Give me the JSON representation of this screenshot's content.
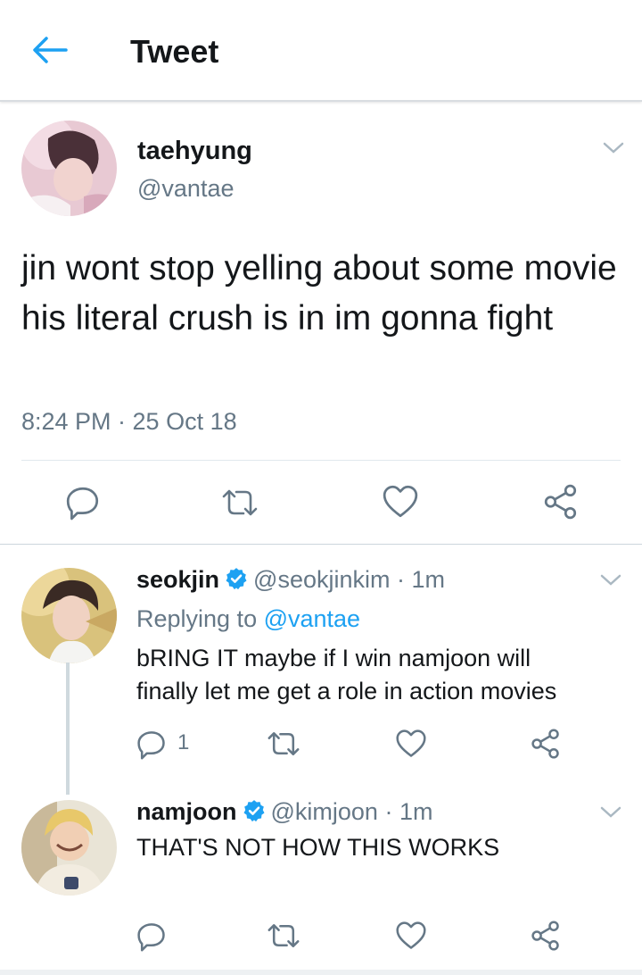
{
  "header": {
    "title": "Tweet"
  },
  "tweet": {
    "name": "taehyung",
    "handle": "@vantae",
    "text": "jin wont stop yelling about some movie his literal crush is in im gonna fight",
    "timestamp": "8:24 PM · 25 Oct 18"
  },
  "replies": [
    {
      "name": "seokjin",
      "handle": "@seokjinkim · 1m",
      "replying_prefix": "Replying to ",
      "replying_handle": "@vantae",
      "text_line1": "bRING IT maybe if I win namjoon will",
      "text_line2": "finally let me get a role in action movies",
      "reply_count": "1"
    },
    {
      "name": "namjoon",
      "handle": "@kimjoon · 1m",
      "text": "THAT'S NOT HOW THIS WORKS"
    }
  ],
  "colors": {
    "accent": "#1da1f2",
    "secondary_text": "#657786",
    "icon_gray": "#657786"
  },
  "icons": [
    "back-arrow-icon",
    "chevron-down-icon",
    "reply-icon",
    "retweet-icon",
    "like-icon",
    "share-icon",
    "verified-badge-icon"
  ]
}
